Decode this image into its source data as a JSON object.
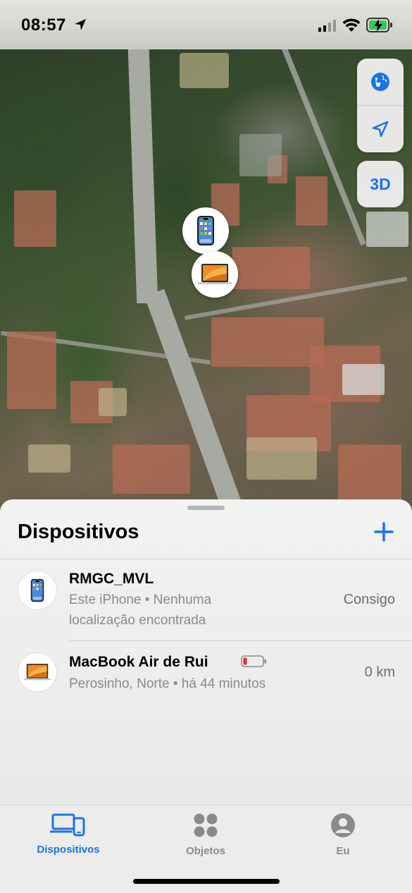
{
  "status_bar": {
    "time": "08:57"
  },
  "map": {
    "buttons": {
      "globe": "globe-icon",
      "locate": "location-arrow-icon",
      "three_d_label": "3D"
    },
    "pins": [
      "iphone-pin",
      "macbook-pin"
    ]
  },
  "sheet": {
    "title": "Dispositivos",
    "add_icon": "plus-icon",
    "devices": [
      {
        "name": "RMGC_MVL",
        "subtitle": "Este iPhone • Nenhuma localização encontrada",
        "distance": "Consigo",
        "icon": "iphone-icon"
      },
      {
        "name": "MacBook Air de Rui",
        "subtitle": "Perosinho, Norte • há 44 minutos",
        "distance": "0 km",
        "icon": "macbook-icon",
        "battery_low": true
      }
    ]
  },
  "tab_bar": {
    "tabs": [
      {
        "label": "Dispositivos",
        "active": true
      },
      {
        "label": "Objetos",
        "active": false
      },
      {
        "label": "Eu",
        "active": false
      }
    ]
  },
  "colors": {
    "accent": "#1a73e8",
    "battery_green": "#34c759",
    "battery_low": "#e0302a"
  }
}
